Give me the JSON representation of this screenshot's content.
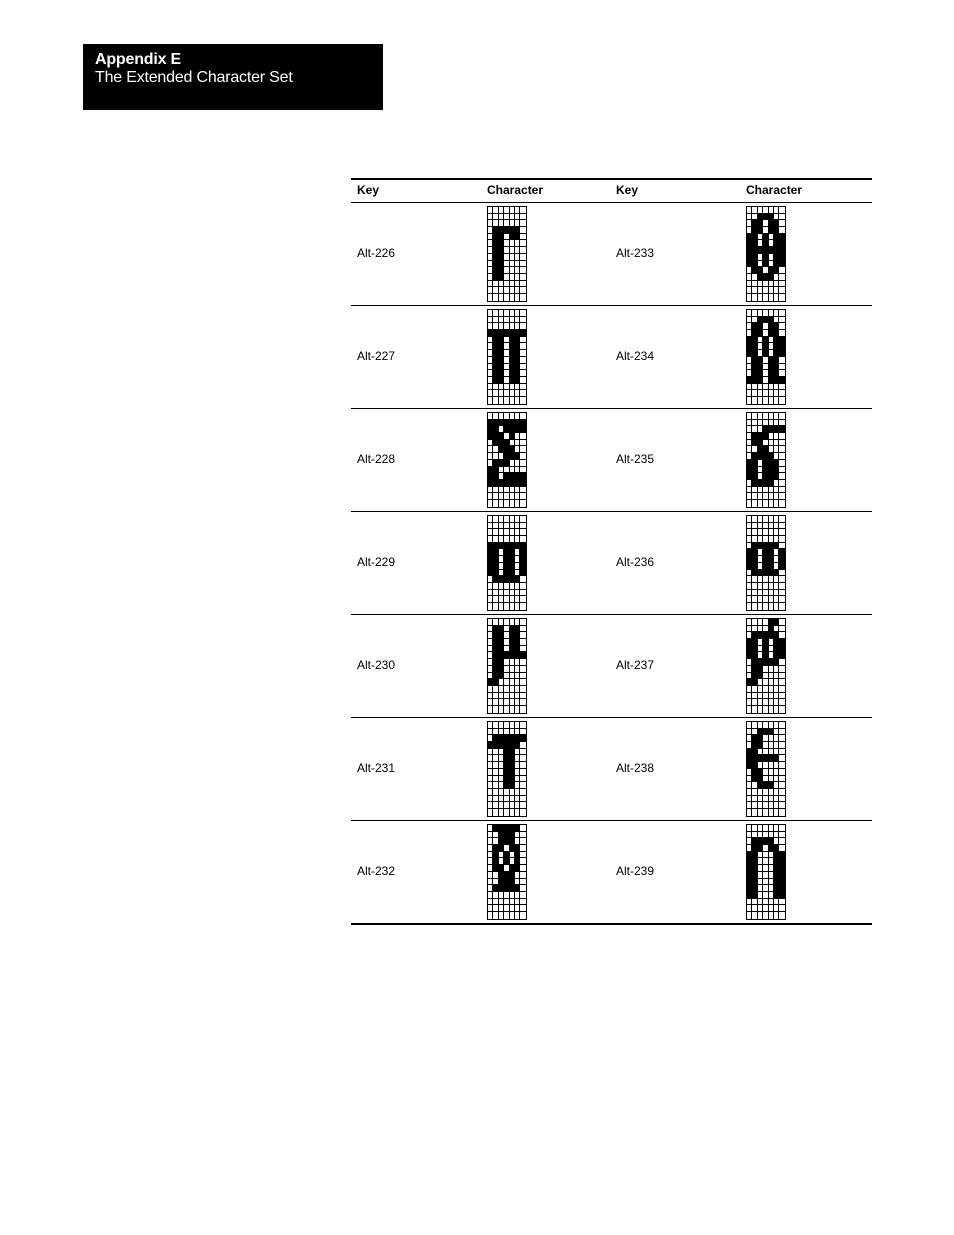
{
  "header": {
    "appendix": "Appendix E",
    "title": "The Extended Character Set"
  },
  "table": {
    "columns": [
      "Key",
      "Character",
      "Key",
      "Character"
    ],
    "rows": [
      {
        "left": {
          "key": "Alt-226",
          "name": "gamma",
          "bitmap": [
            "0000000",
            "0000000",
            "0000000",
            "0111110",
            "0110110",
            "0110000",
            "0110000",
            "0110000",
            "0110000",
            "0110000",
            "0110000",
            "0000000",
            "0000000",
            "0000000"
          ]
        },
        "right": {
          "key": "Alt-233",
          "name": "theta",
          "bitmap": [
            "0000000",
            "0011100",
            "0110110",
            "0110110",
            "1101011",
            "1101011",
            "1111111",
            "1101011",
            "1101011",
            "0110110",
            "0011100",
            "0000000",
            "0000000",
            "0000000"
          ]
        }
      },
      {
        "left": {
          "key": "Alt-227",
          "name": "pi",
          "bitmap": [
            "0000000",
            "0000000",
            "0000000",
            "1111111",
            "0110110",
            "0110110",
            "0110110",
            "0110110",
            "0110110",
            "0110110",
            "0110110",
            "0000000",
            "0000000",
            "0000000"
          ]
        },
        "right": {
          "key": "Alt-234",
          "name": "omega",
          "bitmap": [
            "0000000",
            "0011100",
            "0110110",
            "0110110",
            "1101011",
            "1101011",
            "1101011",
            "0110110",
            "0110110",
            "0110110",
            "1110111",
            "0000000",
            "0000000",
            "0000000"
          ]
        }
      },
      {
        "left": {
          "key": "Alt-228",
          "name": "sigma",
          "bitmap": [
            "0000000",
            "1111111",
            "1101111",
            "1110100",
            "0111000",
            "0011100",
            "0001110",
            "0111000",
            "1100000",
            "1101111",
            "1111111",
            "0000000",
            "0000000",
            "0000000"
          ]
        },
        "right": {
          "key": "Alt-235",
          "name": "delta",
          "bitmap": [
            "0000000",
            "0000000",
            "0001111",
            "0111000",
            "0110000",
            "0011000",
            "0111100",
            "1101110",
            "1101110",
            "1101110",
            "0111100",
            "0000000",
            "0000000",
            "0000000"
          ]
        }
      },
      {
        "left": {
          "key": "Alt-229",
          "name": "sigma-small",
          "bitmap": [
            "0000000",
            "0000000",
            "0000000",
            "0000000",
            "1111111",
            "1101101",
            "1101101",
            "1101101",
            "1101101",
            "0111110",
            "0000000",
            "0000000",
            "0000000",
            "0000000"
          ]
        },
        "right": {
          "key": "Alt-236",
          "name": "infinity",
          "bitmap": [
            "0000000",
            "0000000",
            "0000000",
            "0000000",
            "0111110",
            "1101101",
            "1101101",
            "1101101",
            "0111110",
            "0000000",
            "0000000",
            "0000000",
            "0000000",
            "0000000"
          ]
        }
      },
      {
        "left": {
          "key": "Alt-230",
          "name": "mu",
          "bitmap": [
            "0000000",
            "0110110",
            "0110110",
            "0110110",
            "0110110",
            "0111111",
            "0110000",
            "0110000",
            "0110000",
            "1100000",
            "0000000",
            "0000000",
            "0000000",
            "0000000"
          ]
        },
        "right": {
          "key": "Alt-237",
          "name": "phi",
          "bitmap": [
            "0000110",
            "0000100",
            "0111110",
            "1101011",
            "1101011",
            "1101011",
            "0111110",
            "0110000",
            "0110000",
            "1100000",
            "0000000",
            "0000000",
            "0000000",
            "0000000"
          ]
        }
      },
      {
        "left": {
          "key": "Alt-231",
          "name": "tau",
          "bitmap": [
            "0000000",
            "0000000",
            "0111111",
            "1111110",
            "0001100",
            "0001100",
            "0001100",
            "0001100",
            "0001100",
            "0001100",
            "0000000",
            "0000000",
            "0000000",
            "0000000"
          ]
        },
        "right": {
          "key": "Alt-238",
          "name": "epsilon",
          "bitmap": [
            "0000000",
            "0011100",
            "0110000",
            "0110000",
            "1100000",
            "1111110",
            "1100000",
            "0110000",
            "0110000",
            "0011100",
            "0000000",
            "0000000",
            "0000000",
            "0000000"
          ]
        }
      },
      {
        "left": {
          "key": "Alt-232",
          "name": "phi-capital",
          "bitmap": [
            "0111110",
            "0011100",
            "0011100",
            "0110110",
            "0101010",
            "0101010",
            "0110110",
            "0011100",
            "0011100",
            "0111110",
            "0000000",
            "0000000",
            "0000000",
            "0000000"
          ]
        },
        "right": {
          "key": "Alt-239",
          "name": "intersection",
          "bitmap": [
            "0000000",
            "0000000",
            "0111100",
            "0110110",
            "1100011",
            "1100011",
            "1100011",
            "1100011",
            "1100011",
            "1100011",
            "1100011",
            "0000000",
            "0000000",
            "0000000"
          ]
        }
      }
    ]
  }
}
